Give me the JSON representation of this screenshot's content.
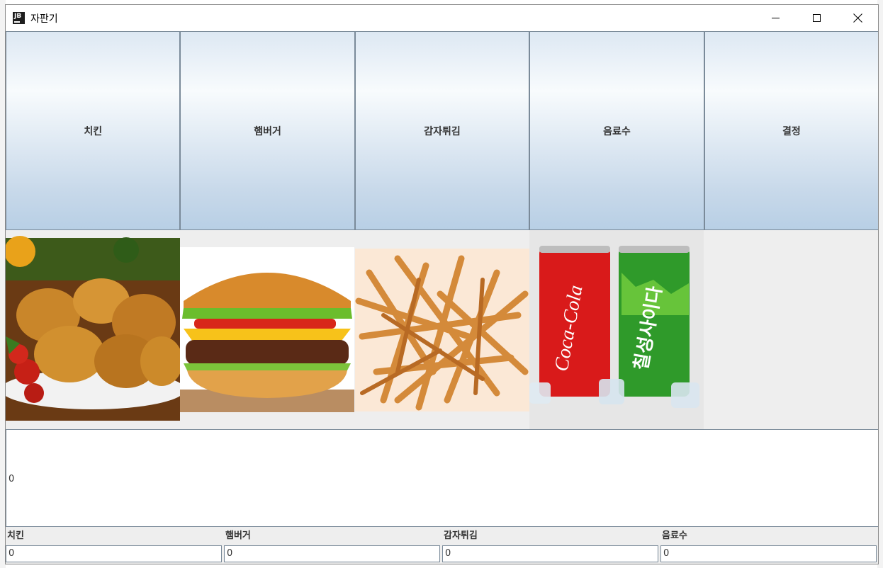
{
  "window": {
    "title": "자판기",
    "icon_text": "JB"
  },
  "menu_buttons": [
    {
      "label": "치킨"
    },
    {
      "label": "햄버거"
    },
    {
      "label": "감자튀김"
    },
    {
      "label": "음료수"
    },
    {
      "label": "결정"
    }
  ],
  "images": [
    {
      "name": "chicken-image"
    },
    {
      "name": "hamburger-image"
    },
    {
      "name": "fries-image"
    },
    {
      "name": "drinks-image",
      "can1_text": "Coca-Cola",
      "can2_text": "칠성사이다"
    }
  ],
  "output": {
    "value": "0"
  },
  "counts": [
    {
      "label": "치킨",
      "value": "0"
    },
    {
      "label": "햄버거",
      "value": "0"
    },
    {
      "label": "감자튀김",
      "value": "0"
    },
    {
      "label": "음료수",
      "value": "0"
    }
  ],
  "colors": {
    "button_gradient_top": "#dde8f3",
    "button_gradient_bottom": "#b8cfe5",
    "border": "#7a8a99"
  }
}
